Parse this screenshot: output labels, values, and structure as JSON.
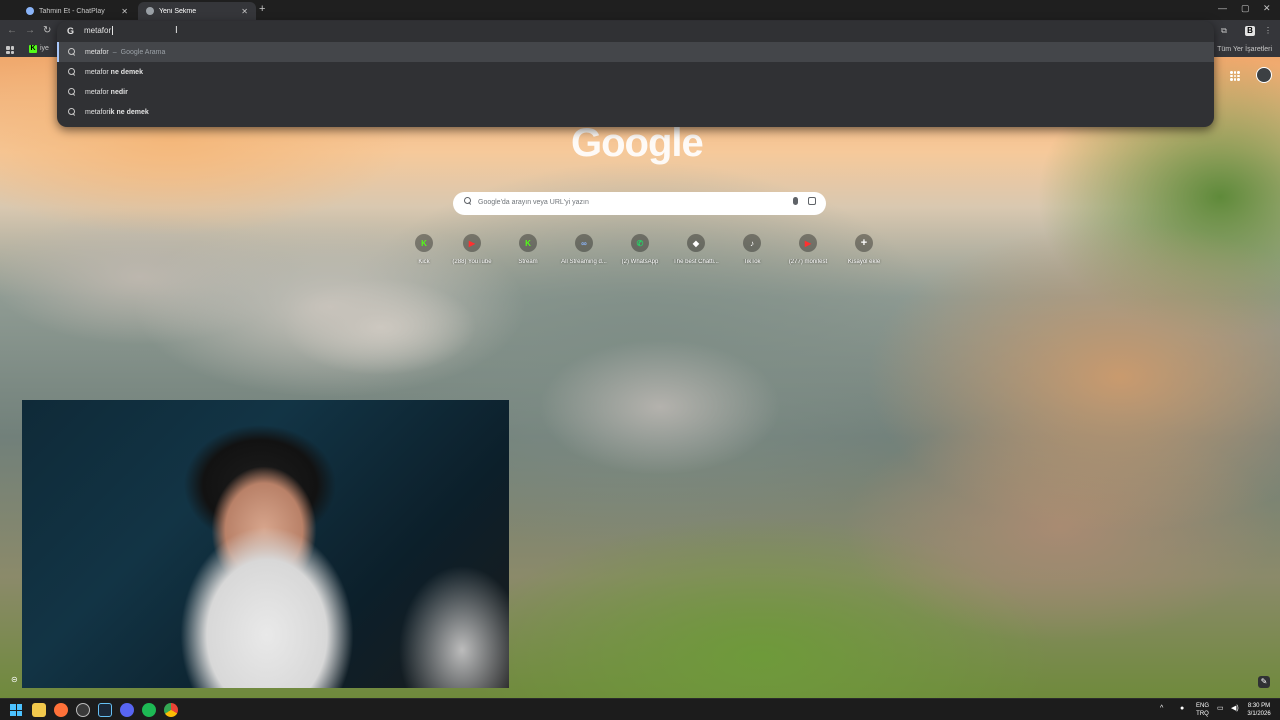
{
  "tabs": [
    {
      "title": "Tahmin Et - ChatPlay",
      "active": false,
      "favicon_color": "#8ab4f8"
    },
    {
      "title": "Yeni Sekme",
      "active": true,
      "favicon_color": "#9aa0a6"
    }
  ],
  "new_tab_symbol": "+",
  "window_controls": {
    "minimize": "—",
    "maximize": "▢",
    "close": "✕"
  },
  "omnibox": {
    "value": "metafor",
    "suggestions": [
      {
        "prefix": "metafor",
        "rest": "",
        "separator": "–",
        "subtext": "Google Arama",
        "selected": true
      },
      {
        "prefix": "metafor",
        "rest": " ne demek",
        "separator": "",
        "subtext": "",
        "selected": false
      },
      {
        "prefix": "metafor",
        "rest": " nedir",
        "separator": "",
        "subtext": "",
        "selected": false
      },
      {
        "prefix": "metafor",
        "rest": "ik ne demek",
        "separator": "",
        "subtext": "",
        "selected": false
      }
    ]
  },
  "bookmarks": {
    "kick_label": "iye",
    "all_bookmarks": "Tüm Yer İşaretleri"
  },
  "ntp": {
    "logo": "Google",
    "search_placeholder": "Google'da arayın veya URL'yi yazın",
    "shortcuts": [
      {
        "label": "Kick",
        "icon": "kick-icon",
        "glyph": "K",
        "color": "#53fc18"
      },
      {
        "label": "(288) YouTube",
        "icon": "youtube-icon",
        "glyph": "▶",
        "color": "#ff0000"
      },
      {
        "label": "Stream",
        "icon": "kick-icon",
        "glyph": "K",
        "color": "#53fc18"
      },
      {
        "label": "All Streaming d...",
        "icon": "streaming-icon",
        "glyph": "∞",
        "color": "#5b7cfa"
      },
      {
        "label": "(2) WhatsApp",
        "icon": "whatsapp-icon",
        "glyph": "✆",
        "color": "#25d366"
      },
      {
        "label": "The best Chatti...",
        "icon": "chat-icon",
        "glyph": "◆",
        "color": "#222222"
      },
      {
        "label": "TikTok",
        "icon": "tiktok-icon",
        "glyph": "♪",
        "color": "#111111"
      },
      {
        "label": "(277) monifest",
        "icon": "youtube-icon",
        "glyph": "▶",
        "color": "#ff0000"
      },
      {
        "label": "Kısayol ekle",
        "icon": "add-icon",
        "glyph": "+",
        "color": "#5f6368"
      }
    ]
  },
  "taskbar": {
    "lang_top": "ENG",
    "lang_bottom": "TRQ",
    "time": "8:30 PM",
    "date": "3/1/2026",
    "apps": [
      "windows-start-icon",
      "file-explorer-icon",
      "firefox-icon",
      "app-icon",
      "steam-icon",
      "discord-icon",
      "spotify-icon",
      "chrome-icon"
    ]
  },
  "colors": {
    "accent": "#a8c7fa",
    "omnibox_bg": "#303134",
    "toolbar_bg": "#35363a"
  }
}
